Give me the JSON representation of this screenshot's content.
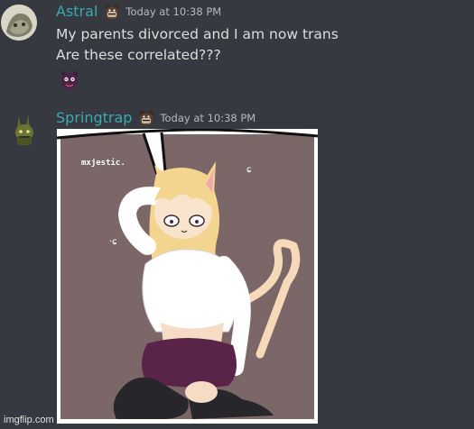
{
  "messages": [
    {
      "username": "Astral",
      "timestamp": "Today at 10:38 PM",
      "lines": [
        "My parents divorced and I am now trans",
        "Are these correlated???"
      ],
      "username_color": "#3ba9ae"
    },
    {
      "username": "Springtrap",
      "timestamp": "Today at 10:38 PM",
      "username_color": "#3ba9ae"
    }
  ],
  "image": {
    "artist_signature": "mxjestic.",
    "description_icon": "anime-catgirl-image"
  },
  "watermark": "imgflip.com",
  "colors": {
    "background": "#36393f",
    "text": "#dcddde",
    "timestamp": "#b6b9bf",
    "username": "#3ba9ae"
  }
}
